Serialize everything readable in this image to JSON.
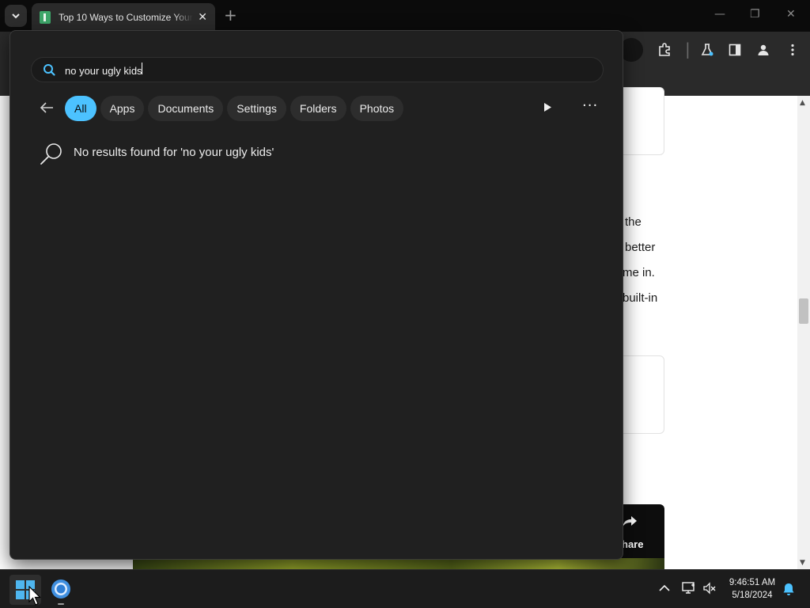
{
  "browser": {
    "tab_title": "Top 10 Ways to Customize Your",
    "tab_close": "✕",
    "new_tab": "+",
    "win_controls": {
      "minimize": "—",
      "restore": "❐",
      "close": "✕"
    }
  },
  "page": {
    "text_lines": [
      "the",
      "better",
      "me in.",
      "built-in"
    ],
    "share_label": "hare"
  },
  "search": {
    "query": "no your ugly kids",
    "filters": [
      {
        "label": "All",
        "active": true
      },
      {
        "label": "Apps",
        "active": false
      },
      {
        "label": "Documents",
        "active": false
      },
      {
        "label": "Settings",
        "active": false
      },
      {
        "label": "Folders",
        "active": false
      },
      {
        "label": "Photos",
        "active": false
      }
    ],
    "more": "···",
    "no_results_text": "No results found for 'no your ugly kids'",
    "accent_color": "#4cc2ff"
  },
  "taskbar": {
    "time": "9:46:51 AM",
    "date": "5/18/2024",
    "pinned": [
      "start-button",
      "chrome"
    ],
    "tray_icons": [
      "chevron-up-icon",
      "network-icon",
      "volume-muted-icon",
      "notification-bell-icon"
    ]
  }
}
